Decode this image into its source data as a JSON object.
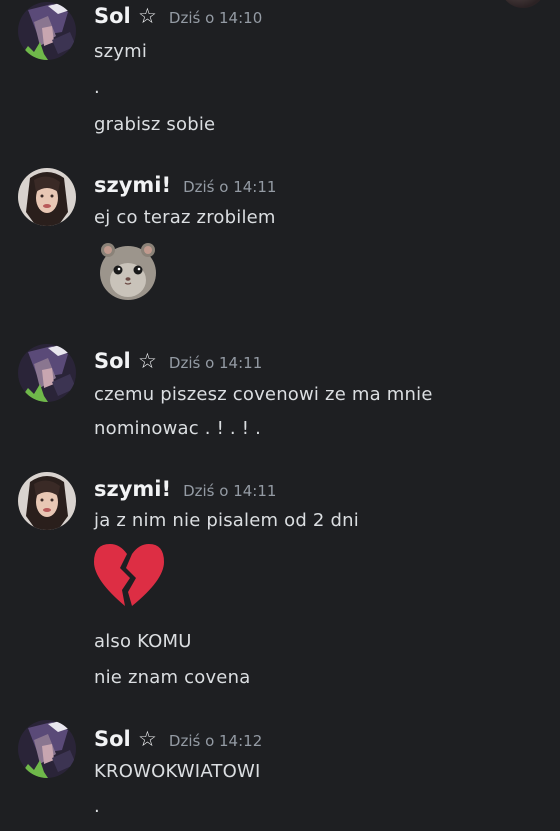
{
  "messages": [
    {
      "author": "Sol ☆",
      "timestamp": "Dziś o 14:10",
      "avatar": "sol-avatar",
      "lines": [
        "szymi",
        ".",
        "grabisz sobie"
      ]
    },
    {
      "author": "szymi!",
      "timestamp": "Dziś o 14:11",
      "avatar": "szymi-avatar",
      "lines": [
        "ej co teraz zrobilem"
      ],
      "emoji": "sad-hamster-emoji"
    },
    {
      "author": "Sol ☆",
      "timestamp": "Dziś o 14:11",
      "avatar": "sol-avatar",
      "lines": [
        "czemu piszesz covenowi ze ma mnie",
        "nominowac . ! . ! ."
      ]
    },
    {
      "author": "szymi!",
      "timestamp": "Dziś o 14:11",
      "avatar": "szymi-avatar",
      "lines": [
        "ja z nim nie pisalem od 2 dni",
        "also KOMU",
        "nie znam covena"
      ],
      "emoji": "broken-heart-emoji"
    },
    {
      "author": "Sol ☆",
      "timestamp": "Dziś o 14:12",
      "avatar": "sol-avatar",
      "lines": [
        "KROWOKWIATOWI",
        "."
      ]
    }
  ],
  "colors": {
    "background": "#1e1f22",
    "author": "#f2f3f5",
    "timestamp": "#949ba4",
    "text": "#dbdee1",
    "broken_heart": "#dd2e44"
  }
}
